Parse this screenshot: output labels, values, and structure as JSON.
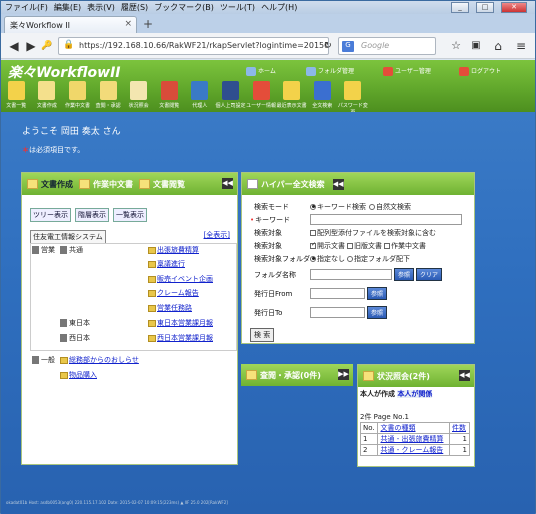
{
  "browser": {
    "menu": [
      "ファイル(F)",
      "編集(E)",
      "表示(V)",
      "履歴(S)",
      "ブックマーク(B)",
      "ツール(T)",
      "ヘルプ(H)"
    ],
    "tab_title": "楽々Workflow II",
    "url": "https://192.168.10.66/RakWF21/rkapServlet?logintime=201502",
    "search_placeholder": "Google",
    "search_engine": "G"
  },
  "app": {
    "logo": "楽々WorkflowII",
    "top_links": [
      "ホーム",
      "フォルダ管理",
      "ユーザー管理",
      "ログアウト"
    ],
    "icons": [
      {
        "label": "文書一覧",
        "icon": "document-list-icon",
        "color": "#f3d24a"
      },
      {
        "label": "文書作成",
        "icon": "document-create-icon",
        "color": "#f4e08c"
      },
      {
        "label": "作業中文書",
        "icon": "work-document-icon",
        "color": "#f0d76a"
      },
      {
        "label": "査閲・承認",
        "icon": "approve-icon",
        "color": "#f2db7a"
      },
      {
        "label": "状況照会",
        "icon": "status-icon",
        "color": "#f3e6b0"
      },
      {
        "label": "文書閲覧",
        "icon": "browse-icon",
        "color": "#d84c3a"
      },
      {
        "label": "代理人",
        "icon": "proxy-icon",
        "color": "#3a7ac6"
      },
      {
        "label": "個人上司設定",
        "icon": "boss-icon",
        "color": "#2f4f8f"
      },
      {
        "label": "ユーザー情報",
        "icon": "user-info-icon",
        "color": "#e44d3a"
      },
      {
        "label": "最近表示文書",
        "icon": "recent-icon",
        "color": "#f3d24a"
      },
      {
        "label": "全文検索",
        "icon": "hyper-search-icon",
        "color": "#3b6fd0"
      },
      {
        "label": "パスワード変更",
        "icon": "password-icon",
        "color": "#f3d24a"
      }
    ],
    "welcome": "ようこそ 岡田 奏太 さん",
    "required_note": "は必須項目です。",
    "required_mark": "＊"
  },
  "left_panel": {
    "tabs": [
      "文書作成",
      "作業中文書",
      "文書閲覧"
    ],
    "buttons": [
      "ツリー表示",
      "階層表示",
      "一覧表示"
    ],
    "system": "住友電工情報システム",
    "all_link": "[全表示]",
    "tree": [
      {
        "level": 0,
        "label": "営業",
        "type": "cabinet"
      },
      {
        "level": 1,
        "label": "共通",
        "type": "cabinet"
      },
      {
        "level": 2,
        "label": "出張旅費精算",
        "type": "folder"
      },
      {
        "level": 2,
        "label": "稟議進行",
        "type": "folder"
      },
      {
        "level": 2,
        "label": "販売イベント企画",
        "type": "folder"
      },
      {
        "level": 2,
        "label": "クレーム報告",
        "type": "folder"
      },
      {
        "level": 2,
        "label": "営業任務路",
        "type": "folder"
      },
      {
        "level": 1,
        "label": "東日本",
        "type": "cabinet"
      },
      {
        "level": 2,
        "label": "東日本営業課月報",
        "type": "folder"
      },
      {
        "level": 1,
        "label": "西日本",
        "type": "cabinet"
      },
      {
        "level": 2,
        "label": "西日本営業課月報",
        "type": "folder"
      },
      {
        "level": 0,
        "label": "一般",
        "type": "cabinet"
      },
      {
        "level": 1,
        "label": "総務部からのおしらせ",
        "type": "folder"
      },
      {
        "level": 1,
        "label": "物品購入",
        "type": "folder"
      }
    ]
  },
  "search_panel": {
    "title": "ハイパー全文検索",
    "labels": {
      "mode": "検索モード",
      "keyword": "キーワード",
      "target1": "検索対象",
      "target2": "検索対象",
      "folder": "検索対象フォルダ",
      "folder_name": "フォルダ名称",
      "from": "発行日From",
      "to": "発行日To"
    },
    "mode_options": [
      "キーワード検索",
      "自然文検索"
    ],
    "target_attach": "配列型添付ファイルを検索対象に含む",
    "target_options": [
      "開示文書",
      "旧版文書",
      "作業中文書"
    ],
    "folder_options": [
      "指定なし",
      "指定フォルダ配下"
    ],
    "ref": "参照",
    "clear": "クリア",
    "search": "検 索"
  },
  "approve_panel": {
    "title": "査閲・承認(0件)"
  },
  "status_panel": {
    "title": "状況照会(2件)",
    "tabs": [
      "本人が作成",
      "本人が関係"
    ],
    "count": "2件 Page No.1",
    "headers": [
      "No.",
      "文書の種類",
      "件数"
    ],
    "rows": [
      {
        "no": "1",
        "kind": "共通 - 出張旅費精算",
        "count": "1"
      },
      {
        "no": "2",
        "kind": "共通 - クレーム報告",
        "count": "1"
      }
    ]
  },
  "status_line": "okadat01b  Host: asdb0053(ang0) 220.115.17.102  Date: 2015-02-07 10:09:15(223ms)  ▲ IIF  25.0  202[RakWF2]"
}
